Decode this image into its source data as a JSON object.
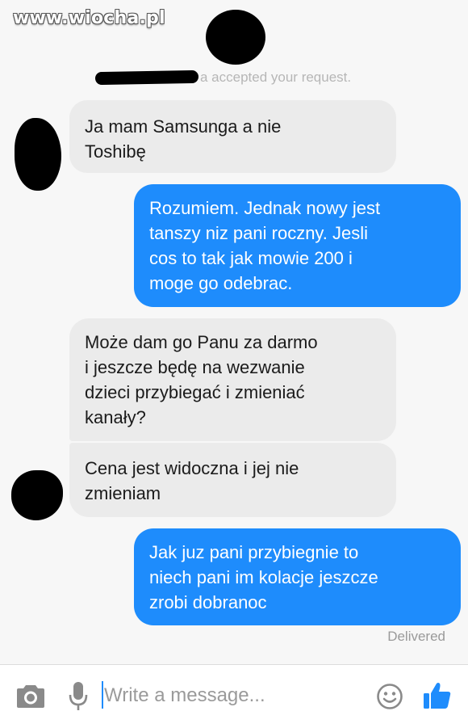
{
  "watermark": "www.wiocha.pl",
  "system_message": "a accepted your request.",
  "messages": [
    {
      "direction": "incoming",
      "text": "Ja mam Samsunga a nie\nToshibę"
    },
    {
      "direction": "outgoing",
      "text": "Rozumiem. Jednak nowy jest\ntanszy niz pani roczny. Jesli\ncos to tak jak mowie 200 i\nmoge go odebrac."
    },
    {
      "direction": "incoming",
      "text": "Może dam go Panu za darmo\ni jeszcze będę na wezwanie\ndzieci przybiegać i zmieniać\nkanały?"
    },
    {
      "direction": "incoming",
      "text": "Cena jest widoczna i jej nie\nzmieniam"
    },
    {
      "direction": "outgoing",
      "text": "Jak juz pani przybiegnie to\nniech pani im kolacje jeszcze\nzrobi dobranoc"
    }
  ],
  "status": "Delivered",
  "composer": {
    "placeholder": "Write a message...",
    "icons": [
      "camera-icon",
      "microphone-icon",
      "emoji-icon",
      "thumbs-up-icon"
    ]
  },
  "colors": {
    "accent": "#1e8cfc",
    "incoming_bubble": "#ebebeb",
    "outgoing_bubble": "#1e8cfc",
    "icon_gray": "#8a8a8a"
  }
}
